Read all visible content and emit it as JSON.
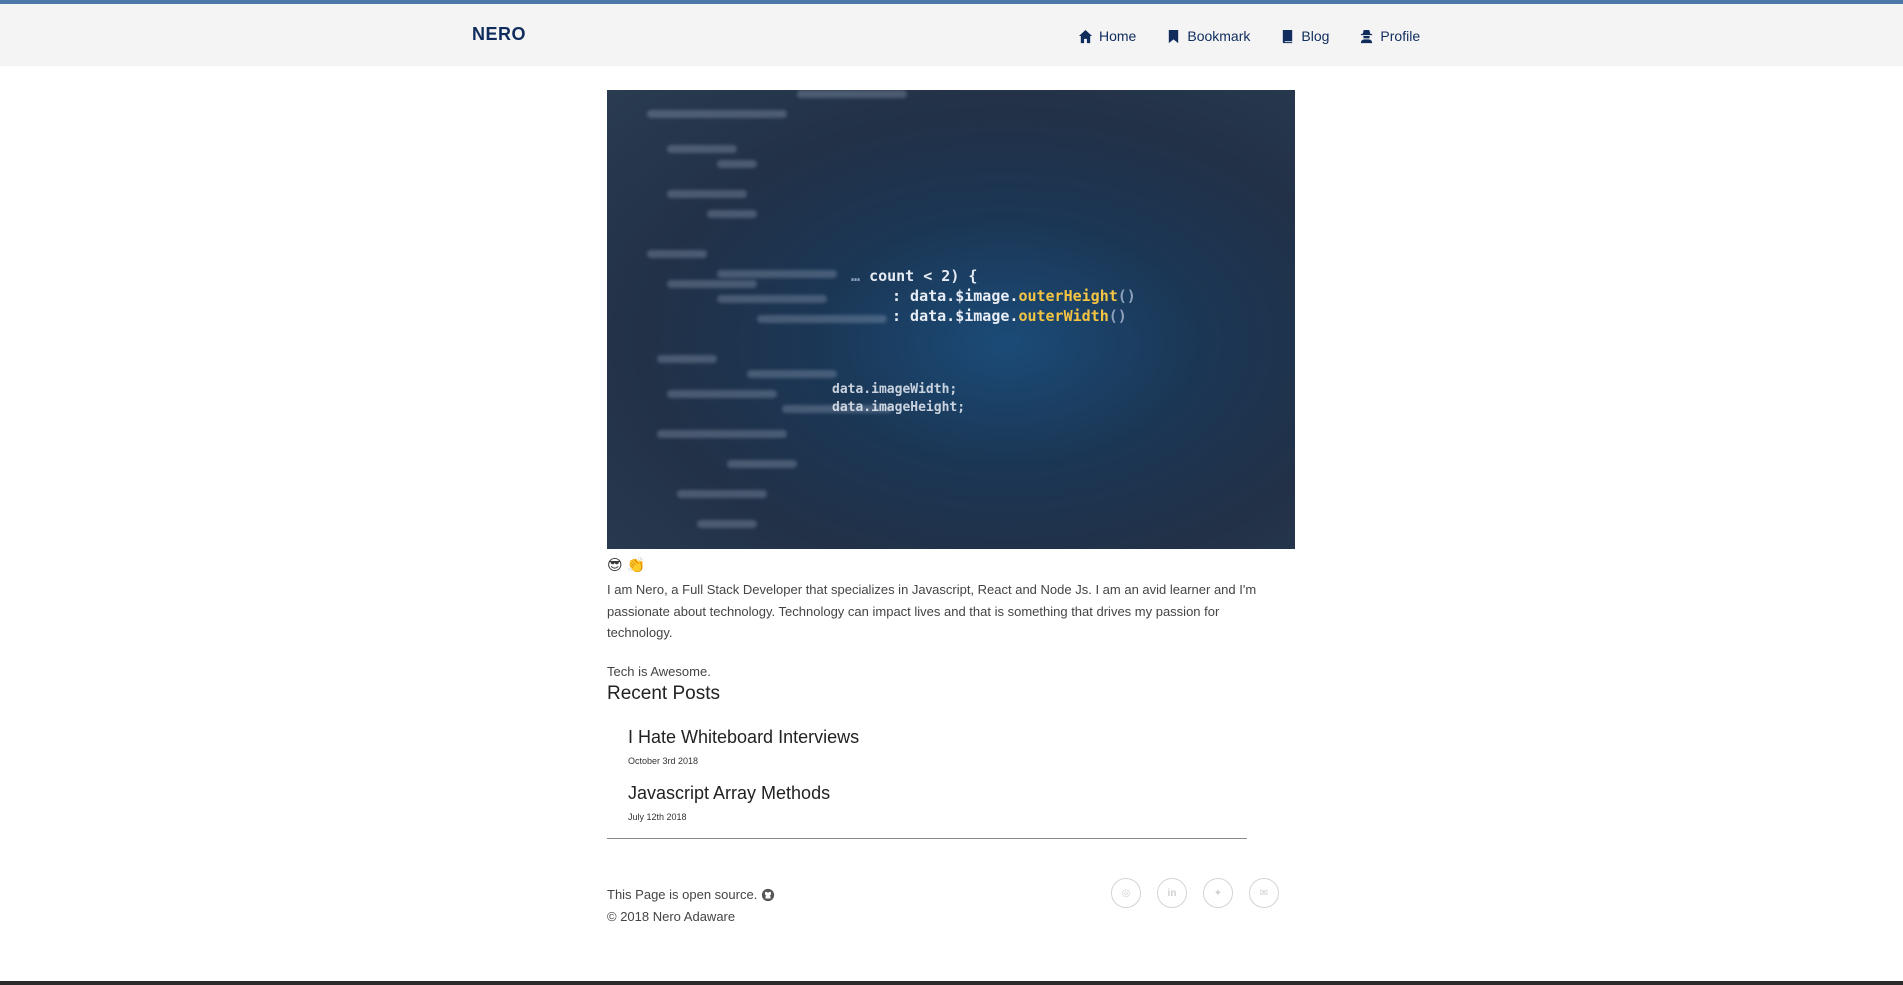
{
  "header": {
    "brand": "NERO",
    "nav": [
      {
        "label": "Home",
        "icon": "home-icon"
      },
      {
        "label": "Bookmark",
        "icon": "bookmark-icon"
      },
      {
        "label": "Blog",
        "icon": "book-icon"
      },
      {
        "label": "Profile",
        "icon": "user-secret-icon"
      }
    ]
  },
  "hero": {
    "code_line1": "count < 2) {",
    "code_line2a": ": data.$image.",
    "code_line2b": "outerHeight",
    "code_line3a": ": data.$image.",
    "code_line3b": "outerWidth",
    "code_line4": "data.imageWidth;",
    "code_line5": "data.imageHeight;"
  },
  "intro": {
    "emojis": [
      "😎",
      "👏"
    ],
    "about": "I am Nero, a Full Stack Developer that specializes in Javascript, React and Node Js. I am an avid learner and I'm passionate about technology. Technology can impact lives and that is something that drives my passion for technology.",
    "tagline": "Tech is Awesome."
  },
  "recent": {
    "title": "Recent Posts",
    "posts": [
      {
        "title": "I Hate Whiteboard Interviews",
        "date": "October 3rd 2018"
      },
      {
        "title": "Javascript Array Methods",
        "date": "July 12th 2018"
      }
    ]
  },
  "footer": {
    "source_text": "This Page is open source.",
    "copyright": "© 2018 Nero Adaware",
    "socials": [
      {
        "name": "github",
        "glyph": "◎"
      },
      {
        "name": "linkedin",
        "glyph": "in"
      },
      {
        "name": "twitter",
        "glyph": "✦"
      },
      {
        "name": "email",
        "glyph": "✉"
      }
    ]
  },
  "colors": {
    "accent": "#4a76a8",
    "nav_text": "#0f2c5c"
  }
}
